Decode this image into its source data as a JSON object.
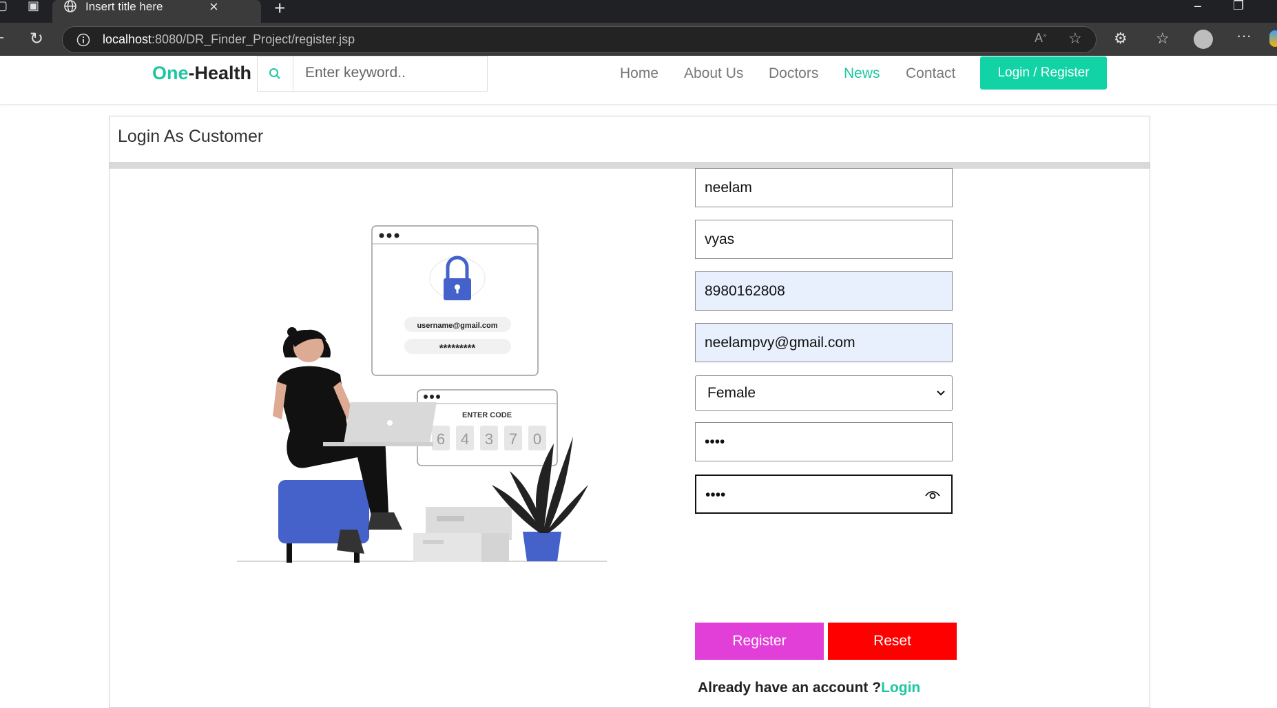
{
  "browser": {
    "tab_title": "Insert title here",
    "url_host": "localhost",
    "url_path": ":8080/DR_Finder_Project/register.jsp"
  },
  "nav": {
    "logo_part1": "One",
    "logo_part2": "-Health",
    "search_placeholder": "Enter keyword..",
    "links": [
      "Home",
      "About Us",
      "Doctors",
      "News",
      "Contact"
    ],
    "active_link": "News",
    "login_label": "Login / Register"
  },
  "card": {
    "title": "Login As Customer"
  },
  "illustration": {
    "login_email": "username@gmail.com",
    "login_password": "*********",
    "code_title": "ENTER CODE",
    "code_digits": [
      "6",
      "4",
      "3",
      "7",
      "0"
    ]
  },
  "form": {
    "first_name": "neelam",
    "last_name": "vyas",
    "phone": "8980162808",
    "email": "neelampvy@gmail.com",
    "gender": "Female",
    "password": "••••",
    "confirm_password": "••••",
    "register_label": "Register",
    "reset_label": "Reset",
    "already_text": "Already have an account ?",
    "login_link": "Login"
  },
  "colors": {
    "accent": "#1cc8a0",
    "login_button": "#12d3a6",
    "register_button": "#e23fd8",
    "reset_button": "#ff0000",
    "autofill_bg": "#e8f0fd"
  }
}
